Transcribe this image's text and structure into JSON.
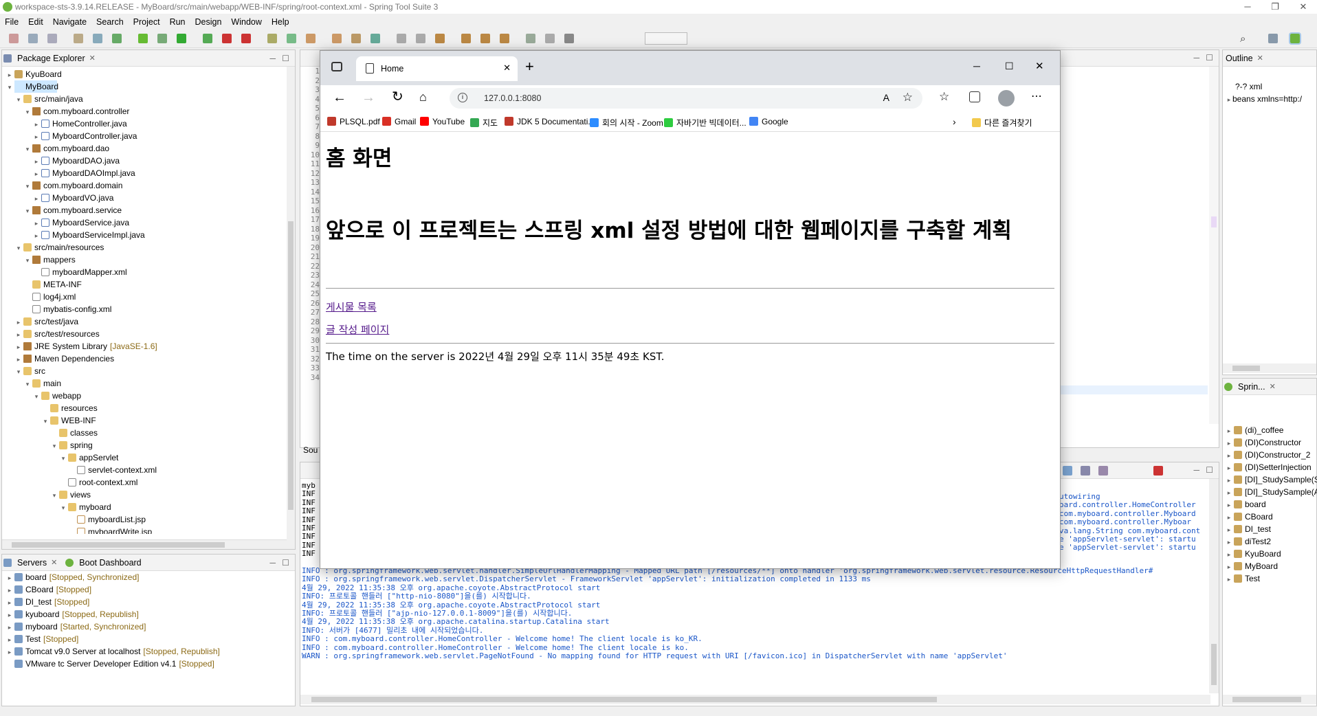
{
  "window": {
    "title": "workspace-sts-3.9.14.RELEASE - MyBoard/src/main/webapp/WEB-INF/spring/root-context.xml - Spring Tool Suite 3",
    "minimize": "─",
    "restore": "❐",
    "close": "✕"
  },
  "menu": [
    "File",
    "Edit",
    "Navigate",
    "Search",
    "Project",
    "Run",
    "Design",
    "Window",
    "Help"
  ],
  "package_explorer": {
    "title": "Package Explorer",
    "items": [
      {
        "d": 0,
        "a": "▸",
        "i": "proj",
        "t": "KyuBoard"
      },
      {
        "d": 0,
        "a": "▾",
        "i": "proj",
        "t": "MyBoard",
        "sel": true
      },
      {
        "d": 1,
        "a": "▾",
        "i": "fold",
        "t": "src/main/java"
      },
      {
        "d": 2,
        "a": "▾",
        "i": "pkg",
        "t": "com.myboard.controller"
      },
      {
        "d": 3,
        "a": "▸",
        "i": "java",
        "t": "HomeController.java"
      },
      {
        "d": 3,
        "a": "▸",
        "i": "java",
        "t": "MyboardController.java"
      },
      {
        "d": 2,
        "a": "▾",
        "i": "pkg",
        "t": "com.myboard.dao"
      },
      {
        "d": 3,
        "a": "▸",
        "i": "java",
        "t": "MyboardDAO.java"
      },
      {
        "d": 3,
        "a": "▸",
        "i": "java",
        "t": "MyboardDAOImpl.java"
      },
      {
        "d": 2,
        "a": "▾",
        "i": "pkg",
        "t": "com.myboard.domain"
      },
      {
        "d": 3,
        "a": "▸",
        "i": "java",
        "t": "MyboardVO.java"
      },
      {
        "d": 2,
        "a": "▾",
        "i": "pkg",
        "t": "com.myboard.service"
      },
      {
        "d": 3,
        "a": "▸",
        "i": "java",
        "t": "MyboardService.java"
      },
      {
        "d": 3,
        "a": "▸",
        "i": "java",
        "t": "MyboardServiceImpl.java"
      },
      {
        "d": 1,
        "a": "▾",
        "i": "fold",
        "t": "src/main/resources"
      },
      {
        "d": 2,
        "a": "▾",
        "i": "pkg",
        "t": "mappers"
      },
      {
        "d": 3,
        "a": "",
        "i": "xml",
        "t": "myboardMapper.xml"
      },
      {
        "d": 2,
        "a": "",
        "i": "fold",
        "t": "META-INF"
      },
      {
        "d": 2,
        "a": "",
        "i": "xml",
        "t": "log4j.xml"
      },
      {
        "d": 2,
        "a": "",
        "i": "xml",
        "t": "mybatis-config.xml"
      },
      {
        "d": 1,
        "a": "▸",
        "i": "fold",
        "t": "src/test/java"
      },
      {
        "d": 1,
        "a": "▸",
        "i": "fold",
        "t": "src/test/resources"
      },
      {
        "d": 1,
        "a": "▸",
        "i": "pkg",
        "t": "JRE System Library",
        "dec": "[JavaSE-1.6]"
      },
      {
        "d": 1,
        "a": "▸",
        "i": "pkg",
        "t": "Maven Dependencies"
      },
      {
        "d": 1,
        "a": "▾",
        "i": "fold",
        "t": "src"
      },
      {
        "d": 2,
        "a": "▾",
        "i": "fold",
        "t": "main"
      },
      {
        "d": 3,
        "a": "▾",
        "i": "fold",
        "t": "webapp"
      },
      {
        "d": 4,
        "a": "",
        "i": "fold",
        "t": "resources"
      },
      {
        "d": 4,
        "a": "▾",
        "i": "fold",
        "t": "WEB-INF"
      },
      {
        "d": 5,
        "a": "",
        "i": "fold",
        "t": "classes"
      },
      {
        "d": 5,
        "a": "▾",
        "i": "fold",
        "t": "spring"
      },
      {
        "d": 6,
        "a": "▾",
        "i": "fold",
        "t": "appServlet"
      },
      {
        "d": 7,
        "a": "",
        "i": "xml",
        "t": "servlet-context.xml"
      },
      {
        "d": 6,
        "a": "",
        "i": "xml",
        "t": "root-context.xml"
      },
      {
        "d": 5,
        "a": "▾",
        "i": "fold",
        "t": "views"
      },
      {
        "d": 6,
        "a": "▾",
        "i": "fold",
        "t": "myboard"
      },
      {
        "d": 7,
        "a": "",
        "i": "jsp",
        "t": "myboardList.jsp"
      },
      {
        "d": 7,
        "a": "",
        "i": "jsp",
        "t": "myboardWrite.jsp"
      }
    ]
  },
  "servers": {
    "tab1": "Servers",
    "tab2": "Boot Dashboard",
    "items": [
      {
        "t": "board",
        "s": "[Stopped, Synchronized]"
      },
      {
        "t": "CBoard",
        "s": "[Stopped]"
      },
      {
        "t": "DI_test",
        "s": "[Stopped]"
      },
      {
        "t": "kyuboard",
        "s": "[Stopped, Republish]"
      },
      {
        "t": "myboard",
        "s": "[Started, Synchronized]"
      },
      {
        "t": "Test",
        "s": "[Stopped]"
      },
      {
        "t": "Tomcat v9.0 Server at localhost",
        "s": "[Stopped, Republish]"
      },
      {
        "t": "VMware tc Server Developer Edition v4.1",
        "s": "[Stopped]",
        "noarrow": true
      }
    ]
  },
  "editor": {
    "line_numbers": [
      "1",
      "2",
      "3",
      "4",
      "5",
      "6",
      "7",
      "8",
      "9",
      "10",
      "11",
      "12",
      "13",
      "14",
      "15",
      "16",
      "17",
      "18",
      "19",
      "20",
      "21",
      "22",
      "23",
      "24",
      "25",
      "26",
      "27",
      "28",
      "29",
      "30",
      "31",
      "32",
      "33",
      "34"
    ],
    "source_tab": "Sou"
  },
  "console": {
    "prefix_lines": [
      "myb",
      "INF",
      "INF",
      "INF",
      "INF",
      "INF",
      "INF",
      "INF",
      "INF"
    ],
    "right_fragments": [
      "utowiring",
      "oard.controller.HomeController",
      "com.myboard.controller.Myboard",
      "com.myboard.controller.Myboar",
      "va.lang.String com.myboard.cont",
      "e 'appServlet-servlet': startu",
      "e 'appServlet-servlet': startu"
    ],
    "lines": [
      "INFO : org.springframework.web.servlet.handler.SimpleUrlHandlerMapping - Mapped URL path [/resources/**] onto handler 'org.springframework.web.servlet.resource.ResourceHttpRequestHandler#",
      "INFO : org.springframework.web.servlet.DispatcherServlet - FrameworkServlet 'appServlet': initialization completed in 1133 ms",
      "4월 29, 2022 11:35:38 오후 org.apache.coyote.AbstractProtocol start",
      "INFO: 프로토콜 핸들러 [\"http-nio-8080\"]을(를) 시작합니다.",
      "4월 29, 2022 11:35:38 오후 org.apache.coyote.AbstractProtocol start",
      "INFO: 프로토콜 핸들러 [\"ajp-nio-127.0.0.1-8009\"]을(를) 시작합니다.",
      "4월 29, 2022 11:35:38 오후 org.apache.catalina.startup.Catalina start",
      "INFO: 서버가 [4677] 밀리초 내에 시작되었습니다.",
      "INFO : com.myboard.controller.HomeController - Welcome home! The client locale is ko_KR.",
      "INFO : com.myboard.controller.HomeController - Welcome home! The client locale is ko.",
      "WARN : org.springframework.web.servlet.PageNotFound - No mapping found for HTTP request with URI [/favicon.ico] in DispatcherServlet with name 'appServlet'"
    ]
  },
  "outline": {
    "title": "Outline",
    "items": [
      "?-? xml",
      "beans xmlns=http:/"
    ]
  },
  "spring_explorer": {
    "title": "Sprin...",
    "items": [
      "(di)_coffee",
      "(DI)Constructor",
      "(DI)Constructor_2",
      "(DI)SetterInjection",
      "[DI]_StudySample(S",
      "[DI]_StudySample(A",
      "board",
      "CBoard",
      "DI_test",
      "diTest2",
      "KyuBoard",
      "MyBoard",
      "Test"
    ]
  },
  "browser": {
    "tab_title": "Home",
    "url": "127.0.0.1:8080",
    "bookmarks": [
      "PLSQL.pdf",
      "Gmail",
      "YouTube",
      "지도",
      "JDK 5 Documentati...",
      "회의 시작 - Zoom",
      "자바기반 빅데이터...",
      "Google"
    ],
    "other_bookmarks": "다른 즐겨찾기",
    "page": {
      "h1": "홈 화면",
      "h2": "앞으로 이 프로젝트는 스프링 xml 설정 방법에 대한 웹페이지를 구축할 계획",
      "link1": "게시물 목록",
      "link2": "글 작성 페이지",
      "server_time": "The time on the server is 2022년 4월 29일 오후 11시 35분 49초 KST."
    }
  },
  "colors": {
    "accent": "#6db33f",
    "selection": "#cde8ff",
    "console_text": "#1a56c8",
    "link": "#551a8b"
  }
}
